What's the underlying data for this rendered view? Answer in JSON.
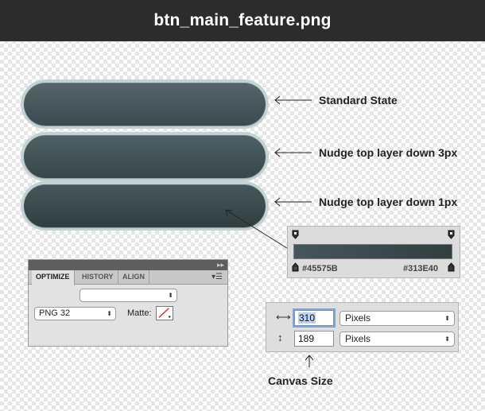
{
  "window": {
    "title": "btn_main_feature.png"
  },
  "annotations": {
    "standard": "Standard State",
    "nudge3": "Nudge top layer down 3px",
    "nudge1": "Nudge top layer down 1px",
    "canvas_size": "Canvas Size"
  },
  "gradient": {
    "left_hex": "#45575B",
    "right_hex": "#313E40",
    "left_color": "#45575b",
    "right_color": "#313e40"
  },
  "optimize_panel": {
    "tabs": [
      "OPTIMIZE",
      "HISTORY",
      "ALIGN"
    ],
    "active_tab": "OPTIMIZE",
    "preset_value": "",
    "format_value": "PNG 32",
    "matte_label": "Matte:",
    "collapse_glyph": "▸▸",
    "menu_glyph": "▾☰"
  },
  "canvas_size": {
    "width_value": "310",
    "height_value": "189",
    "width_unit": "Pixels",
    "height_unit": "Pixels"
  },
  "icons": {
    "width": "⟷",
    "height": "↕",
    "select_arrow": "⬍"
  }
}
